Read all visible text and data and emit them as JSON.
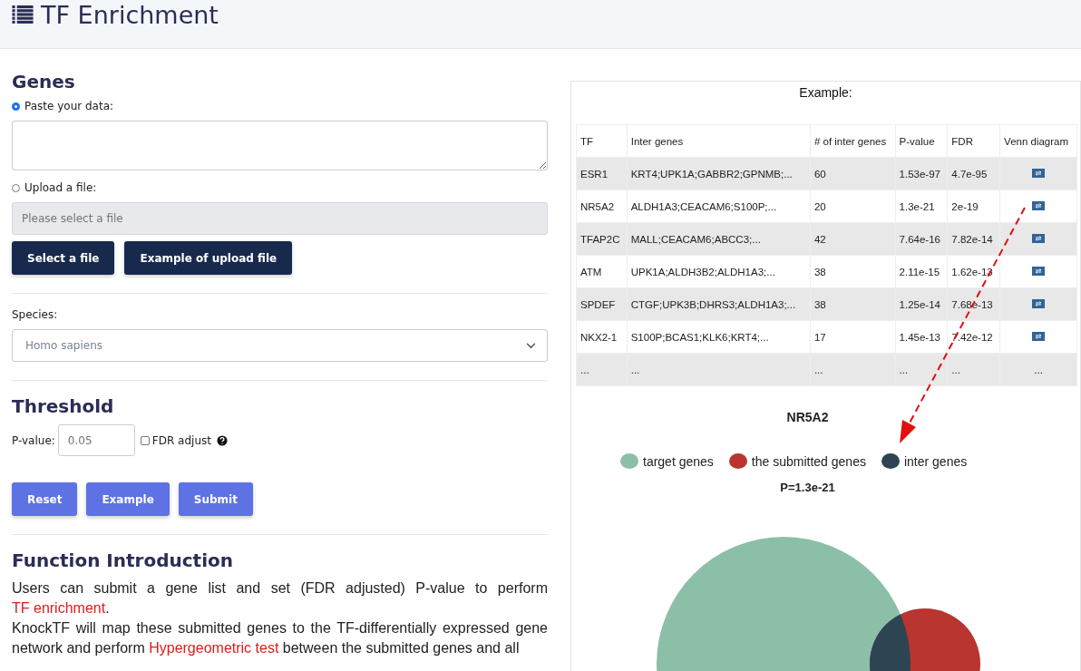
{
  "header": {
    "title": "TF Enrichment"
  },
  "genes": {
    "heading": "Genes",
    "paste": {
      "label": "Paste your data:",
      "selected": true
    },
    "upload": {
      "label": "Upload a file:",
      "selected": false,
      "placeholder": "Please select a file"
    },
    "buttons": [
      "Select a file",
      "Example of upload file"
    ]
  },
  "species": {
    "label": "Species:",
    "value": "Homo sapiens"
  },
  "threshold": {
    "heading": "Threshold",
    "pvalue_label": "P-value:",
    "pvalue_placeholder": "0.05",
    "fdr_label": "FDR adjust",
    "fdr_checked": false,
    "buttons": [
      "Reset",
      "Example",
      "Submit"
    ]
  },
  "intro": {
    "heading": "Function Introduction",
    "paragraphs": [
      [
        {
          "text": "Users can submit a gene list and set (FDR adjusted) P-value to perform "
        },
        {
          "text": "TF enrichment",
          "kind": "link"
        },
        {
          "text": "."
        }
      ],
      [
        {
          "text": "KnockTF will map these submitted genes to the TF-differentially expressed gene network and perform "
        },
        {
          "text": "Hypergeometric test",
          "kind": "link"
        },
        {
          "text": " between the submitted genes and all"
        }
      ]
    ]
  },
  "example": {
    "title": "Example:",
    "columns": [
      "TF",
      "Inter genes",
      "# of inter genes",
      "P-value",
      "FDR",
      "Venn diagram"
    ],
    "rows": [
      {
        "cells": [
          "ESR1",
          "KRT4;UPK1A;GABBR2;GPNMB;...",
          "60",
          "1.53e-97",
          "4.7e-95"
        ],
        "venn": true
      },
      {
        "cells": [
          "NR5A2",
          "ALDH1A3;CEACAM6;S100P;...",
          "20",
          "1.3e-21",
          "2e-19"
        ],
        "venn": true
      },
      {
        "cells": [
          "TFAP2C",
          "MALL;CEACAM6;ABCC3;...",
          "42",
          "7.64e-16",
          "7.82e-14"
        ],
        "venn": true
      },
      {
        "cells": [
          "ATM",
          "UPK1A;ALDH3B2;ALDH1A3;...",
          "38",
          "2.11e-15",
          "1.62e-13"
        ],
        "venn": true
      },
      {
        "cells": [
          "SPDEF",
          "CTGF;UPK3B;DHRS3;ALDH1A3;...",
          "38",
          "1.25e-14",
          "7.68e-13"
        ],
        "venn": true
      },
      {
        "cells": [
          "NKX2-1",
          "S100P;BCAS1;KLK6;KRT4;...",
          "17",
          "1.45e-13",
          "7.42e-12"
        ],
        "venn": true
      },
      {
        "cells": [
          "...",
          "...",
          "...",
          "...",
          "...",
          "..."
        ],
        "venn": false
      }
    ]
  },
  "venn": {
    "title": "NR5A2",
    "legend": [
      {
        "label": "target genes",
        "color": "#8bbfa8"
      },
      {
        "label": "the submitted genes",
        "color": "#b83530"
      },
      {
        "label": "inter genes",
        "color": "#2d4453"
      }
    ],
    "p_label": "P=1.3e-21"
  }
}
